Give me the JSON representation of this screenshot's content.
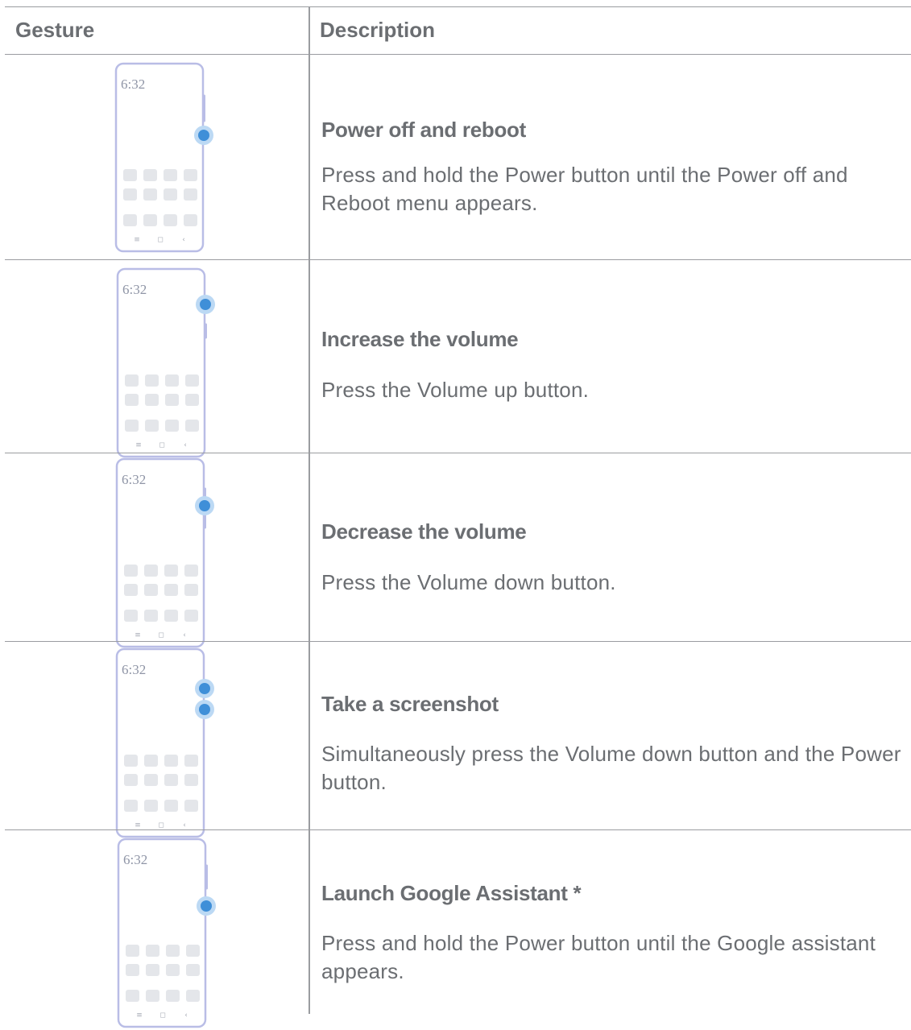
{
  "header": {
    "gesture": "Gesture",
    "description": "Description"
  },
  "rows": [
    {
      "clock": "6:32",
      "title": "Power off and reboot",
      "text": "Press and hold the Power button until the Power off and Reboot menu appears."
    },
    {
      "clock": "6:32",
      "title": "Increase the volume",
      "text": "Press the Volume up button."
    },
    {
      "clock": "6:32",
      "title": "Decrease the volume",
      "text": "Press the Volume down button."
    },
    {
      "clock": "6:32",
      "title": "Take a screenshot",
      "text": "Simultaneously press the Volume down button and the Power button."
    },
    {
      "clock": "6:32",
      "title": "Launch Google Assistant *",
      "text": "Press and hold the Power button until the Google assistant appears."
    }
  ],
  "colors": {
    "outline": "#b9bde6",
    "tile": "#e4e6ea",
    "dot": "#3f8fd8",
    "halo": "#bcd9f4",
    "rule": "#9a9ca0"
  },
  "nav_glyphs": [
    "≡",
    "◻",
    "‹"
  ]
}
